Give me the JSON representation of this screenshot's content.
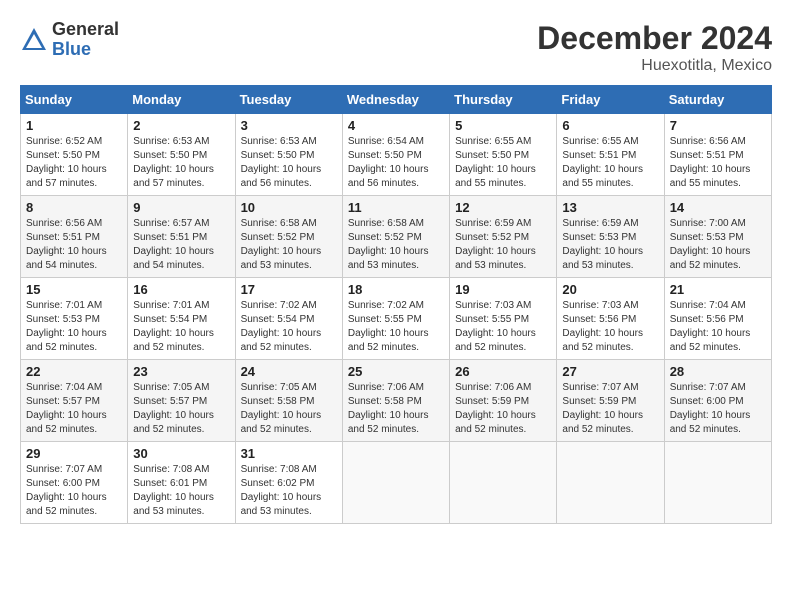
{
  "header": {
    "logo_general": "General",
    "logo_blue": "Blue",
    "month_title": "December 2024",
    "location": "Huexotitla, Mexico"
  },
  "calendar": {
    "headers": [
      "Sunday",
      "Monday",
      "Tuesday",
      "Wednesday",
      "Thursday",
      "Friday",
      "Saturday"
    ],
    "weeks": [
      [
        {
          "day": "1",
          "info": "Sunrise: 6:52 AM\nSunset: 5:50 PM\nDaylight: 10 hours\nand 57 minutes."
        },
        {
          "day": "2",
          "info": "Sunrise: 6:53 AM\nSunset: 5:50 PM\nDaylight: 10 hours\nand 57 minutes."
        },
        {
          "day": "3",
          "info": "Sunrise: 6:53 AM\nSunset: 5:50 PM\nDaylight: 10 hours\nand 56 minutes."
        },
        {
          "day": "4",
          "info": "Sunrise: 6:54 AM\nSunset: 5:50 PM\nDaylight: 10 hours\nand 56 minutes."
        },
        {
          "day": "5",
          "info": "Sunrise: 6:55 AM\nSunset: 5:50 PM\nDaylight: 10 hours\nand 55 minutes."
        },
        {
          "day": "6",
          "info": "Sunrise: 6:55 AM\nSunset: 5:51 PM\nDaylight: 10 hours\nand 55 minutes."
        },
        {
          "day": "7",
          "info": "Sunrise: 6:56 AM\nSunset: 5:51 PM\nDaylight: 10 hours\nand 55 minutes."
        }
      ],
      [
        {
          "day": "8",
          "info": "Sunrise: 6:56 AM\nSunset: 5:51 PM\nDaylight: 10 hours\nand 54 minutes."
        },
        {
          "day": "9",
          "info": "Sunrise: 6:57 AM\nSunset: 5:51 PM\nDaylight: 10 hours\nand 54 minutes."
        },
        {
          "day": "10",
          "info": "Sunrise: 6:58 AM\nSunset: 5:52 PM\nDaylight: 10 hours\nand 53 minutes."
        },
        {
          "day": "11",
          "info": "Sunrise: 6:58 AM\nSunset: 5:52 PM\nDaylight: 10 hours\nand 53 minutes."
        },
        {
          "day": "12",
          "info": "Sunrise: 6:59 AM\nSunset: 5:52 PM\nDaylight: 10 hours\nand 53 minutes."
        },
        {
          "day": "13",
          "info": "Sunrise: 6:59 AM\nSunset: 5:53 PM\nDaylight: 10 hours\nand 53 minutes."
        },
        {
          "day": "14",
          "info": "Sunrise: 7:00 AM\nSunset: 5:53 PM\nDaylight: 10 hours\nand 52 minutes."
        }
      ],
      [
        {
          "day": "15",
          "info": "Sunrise: 7:01 AM\nSunset: 5:53 PM\nDaylight: 10 hours\nand 52 minutes."
        },
        {
          "day": "16",
          "info": "Sunrise: 7:01 AM\nSunset: 5:54 PM\nDaylight: 10 hours\nand 52 minutes."
        },
        {
          "day": "17",
          "info": "Sunrise: 7:02 AM\nSunset: 5:54 PM\nDaylight: 10 hours\nand 52 minutes."
        },
        {
          "day": "18",
          "info": "Sunrise: 7:02 AM\nSunset: 5:55 PM\nDaylight: 10 hours\nand 52 minutes."
        },
        {
          "day": "19",
          "info": "Sunrise: 7:03 AM\nSunset: 5:55 PM\nDaylight: 10 hours\nand 52 minutes."
        },
        {
          "day": "20",
          "info": "Sunrise: 7:03 AM\nSunset: 5:56 PM\nDaylight: 10 hours\nand 52 minutes."
        },
        {
          "day": "21",
          "info": "Sunrise: 7:04 AM\nSunset: 5:56 PM\nDaylight: 10 hours\nand 52 minutes."
        }
      ],
      [
        {
          "day": "22",
          "info": "Sunrise: 7:04 AM\nSunset: 5:57 PM\nDaylight: 10 hours\nand 52 minutes."
        },
        {
          "day": "23",
          "info": "Sunrise: 7:05 AM\nSunset: 5:57 PM\nDaylight: 10 hours\nand 52 minutes."
        },
        {
          "day": "24",
          "info": "Sunrise: 7:05 AM\nSunset: 5:58 PM\nDaylight: 10 hours\nand 52 minutes."
        },
        {
          "day": "25",
          "info": "Sunrise: 7:06 AM\nSunset: 5:58 PM\nDaylight: 10 hours\nand 52 minutes."
        },
        {
          "day": "26",
          "info": "Sunrise: 7:06 AM\nSunset: 5:59 PM\nDaylight: 10 hours\nand 52 minutes."
        },
        {
          "day": "27",
          "info": "Sunrise: 7:07 AM\nSunset: 5:59 PM\nDaylight: 10 hours\nand 52 minutes."
        },
        {
          "day": "28",
          "info": "Sunrise: 7:07 AM\nSunset: 6:00 PM\nDaylight: 10 hours\nand 52 minutes."
        }
      ],
      [
        {
          "day": "29",
          "info": "Sunrise: 7:07 AM\nSunset: 6:00 PM\nDaylight: 10 hours\nand 52 minutes."
        },
        {
          "day": "30",
          "info": "Sunrise: 7:08 AM\nSunset: 6:01 PM\nDaylight: 10 hours\nand 53 minutes."
        },
        {
          "day": "31",
          "info": "Sunrise: 7:08 AM\nSunset: 6:02 PM\nDaylight: 10 hours\nand 53 minutes."
        },
        {
          "day": "",
          "info": ""
        },
        {
          "day": "",
          "info": ""
        },
        {
          "day": "",
          "info": ""
        },
        {
          "day": "",
          "info": ""
        }
      ]
    ]
  }
}
